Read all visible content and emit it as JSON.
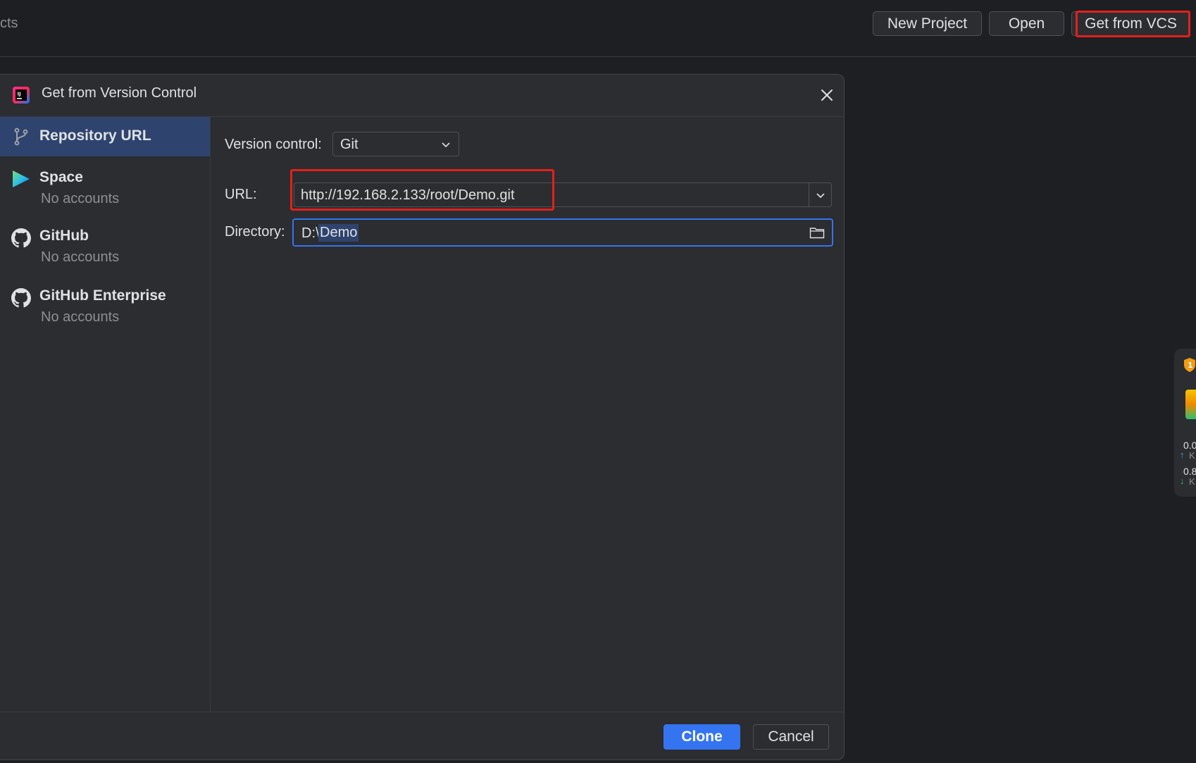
{
  "topbar": {
    "left_text": "cts",
    "new_project": "New Project",
    "open": "Open",
    "get_from_vcs": "Get from VCS"
  },
  "dialog": {
    "title": "Get from Version Control",
    "sidebar": {
      "items": [
        {
          "label": "Repository URL",
          "sub": "",
          "icon": "git-branch-icon"
        },
        {
          "label": "Space",
          "sub": "No accounts",
          "icon": "space-icon"
        },
        {
          "label": "GitHub",
          "sub": "No accounts",
          "icon": "github-icon"
        },
        {
          "label": "GitHub Enterprise",
          "sub": "No accounts",
          "icon": "github-icon"
        }
      ]
    },
    "form": {
      "version_control_label": "Version control:",
      "version_control_value": "Git",
      "url_label": "URL:",
      "url_value": "http://192.168.2.133/root/Demo.git",
      "directory_label": "Directory:",
      "directory_prefix": "D:\\",
      "directory_selected": "Demo"
    },
    "buttons": {
      "clone": "Clone",
      "cancel": "Cancel"
    }
  },
  "widget": {
    "badge": "1",
    "up_value": "0.0",
    "up_unit": "K",
    "down_value": "0.8",
    "down_unit": "K"
  },
  "colors": {
    "accent": "#3574f0",
    "selection": "#2e436e",
    "highlight_box": "#e3201b",
    "background": "#1e1f22",
    "panel": "#2b2d30"
  }
}
